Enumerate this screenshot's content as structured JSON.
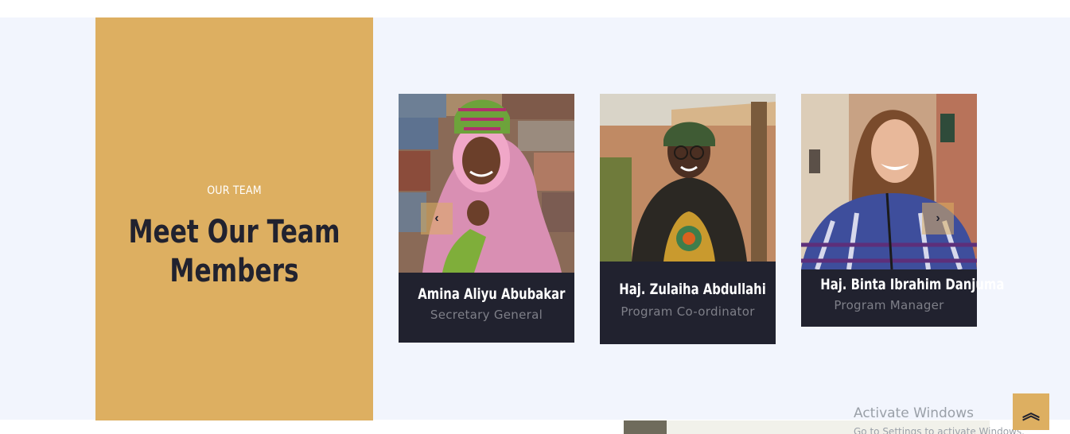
{
  "team_section": {
    "eyebrow": "OUR TEAM",
    "heading": "Meet Our Team Members",
    "accent_color": "#ddaf61",
    "dark_color": "#21222f",
    "members": [
      {
        "name": "Amina Aliyu Abubakar",
        "role": "Secretary General"
      },
      {
        "name": "Haj. Zulaiha Abdullahi",
        "role": "Program Co-ordinator"
      },
      {
        "name": "Haj. Binta Ibrahim Danjuma",
        "role": "Program Manager"
      }
    ],
    "prev_icon": "chevron-left-icon",
    "next_icon": "chevron-right-icon",
    "prev_glyph": "‹",
    "next_glyph": "›"
  },
  "scroll_top": {
    "icon": "double-chevron-up-icon",
    "glyph": "︽"
  },
  "watermark": {
    "line1": "Activate Windows",
    "line2": "Go to Settings to activate Windows."
  }
}
